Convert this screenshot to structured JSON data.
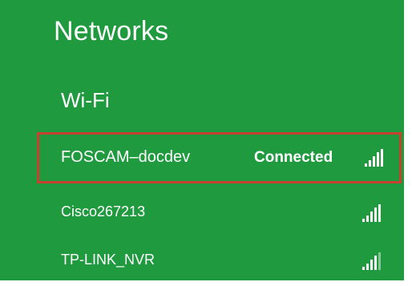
{
  "panel": {
    "title": "Networks",
    "section": "Wi-Fi",
    "networks": [
      {
        "name": "FOSCAM–docdev",
        "status": "Connected",
        "signal_icon": "wifi-signal-icon",
        "signal_level": 5
      },
      {
        "name": "Cisco267213",
        "status": "",
        "signal_icon": "wifi-signal-icon",
        "signal_level": 5
      },
      {
        "name": "TP-LINK_NVR",
        "status": "",
        "signal_icon": "wifi-signal-icon",
        "signal_level": 4
      }
    ]
  },
  "colors": {
    "background": "#1f9a3f",
    "selected_border": "#c8402f",
    "text": "#ffffff"
  }
}
